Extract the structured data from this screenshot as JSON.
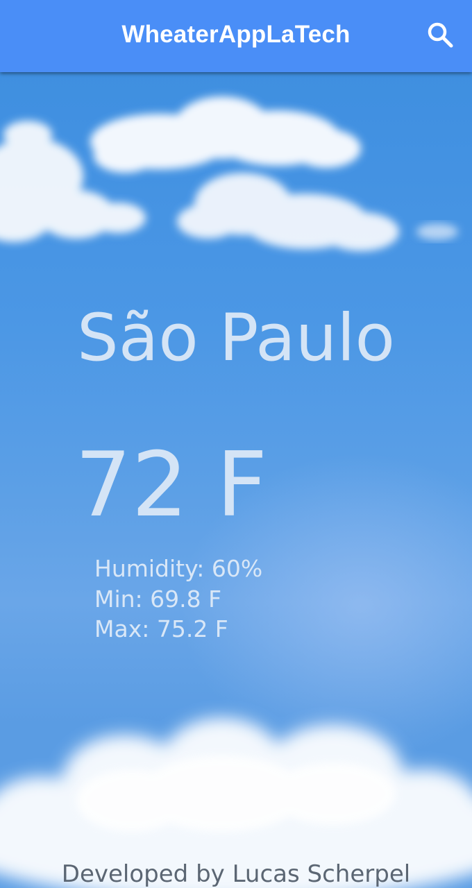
{
  "app": {
    "title": "WheaterAppLaTech",
    "accent_color": "#4a8ef7"
  },
  "toolbar": {
    "search_icon": "search-icon"
  },
  "weather": {
    "city": "São Paulo",
    "temperature": "72 F",
    "humidity": "Humidity: 60%",
    "min": "Min: 69.8 F",
    "max": "Max: 75.2 F"
  },
  "footer": {
    "credit": "Developed by Lucas Scherpel"
  }
}
